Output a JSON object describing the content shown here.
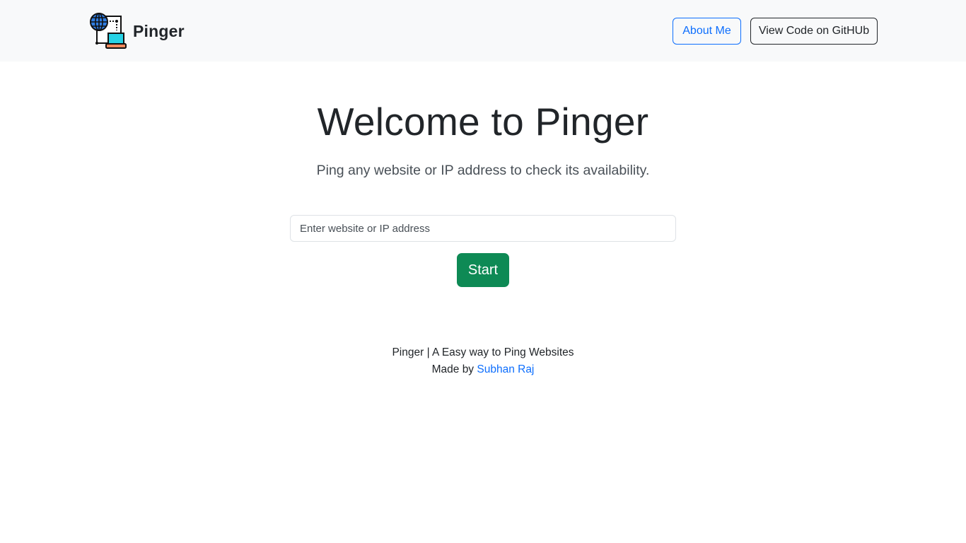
{
  "navbar": {
    "brand_name": "Pinger",
    "logo_icon": "network-computer-icon",
    "about_label": "About Me",
    "github_label": "View Code on GitHUb"
  },
  "hero": {
    "title": "Welcome to Pinger",
    "subtitle": "Ping any website or IP address to check its availability."
  },
  "search": {
    "placeholder": "Enter website or IP address",
    "value": ""
  },
  "start_button": {
    "label": "Start"
  },
  "footer": {
    "tagline": "Pinger | A Easy way to Ping Websites",
    "made_by_prefix": "Made by ",
    "author": "Subhan Raj"
  },
  "colors": {
    "navbar_bg": "#f8f9fa",
    "primary": "#0d6efd",
    "success": "#0e8a55",
    "text": "#212529"
  }
}
